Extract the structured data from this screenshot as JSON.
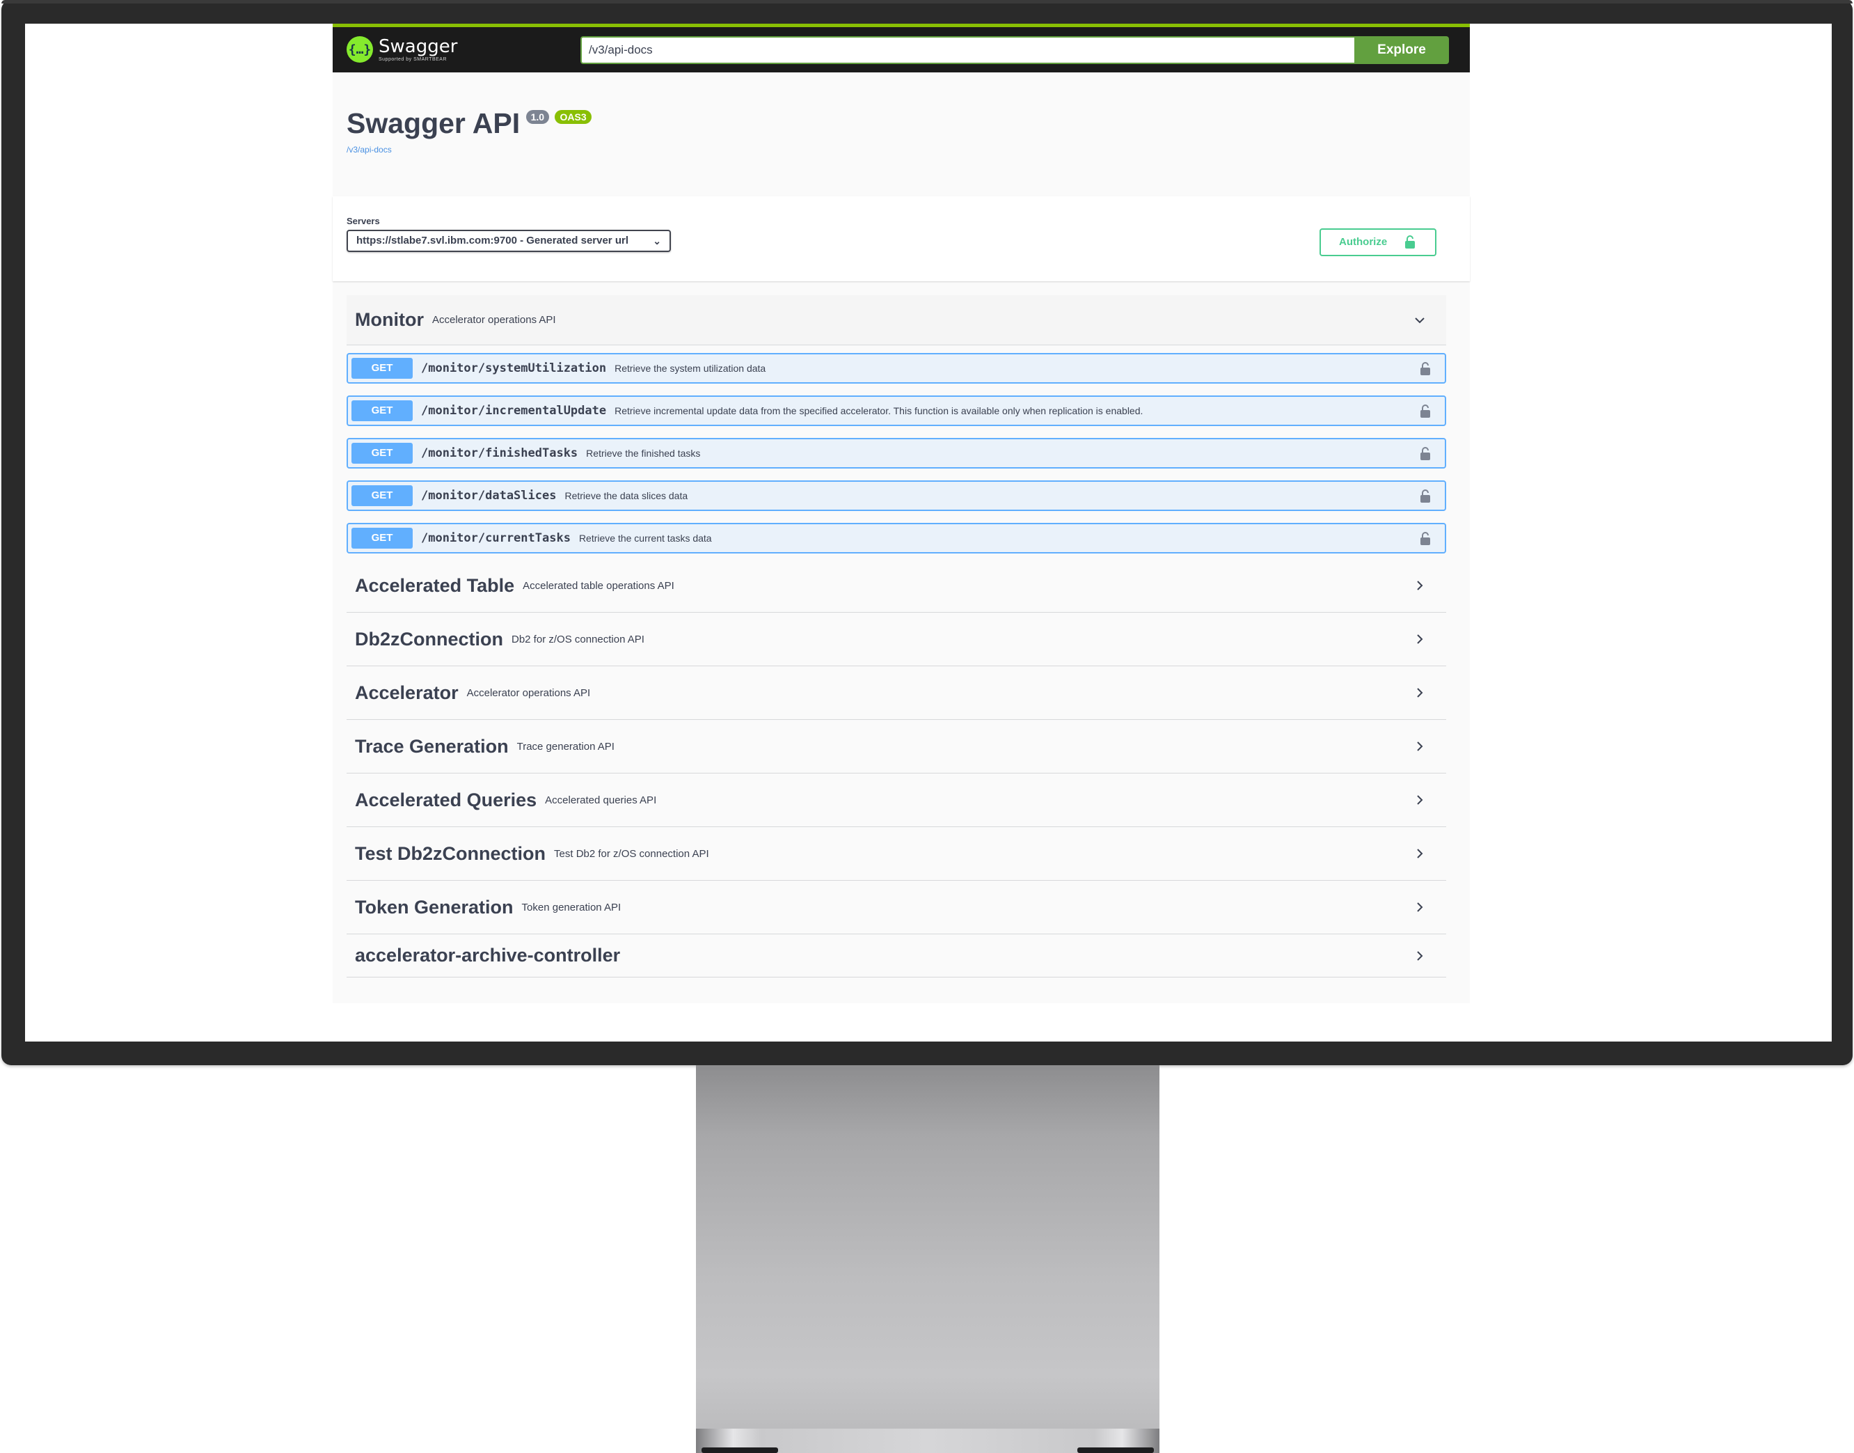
{
  "topbar": {
    "logo_title": "Swagger",
    "logo_subtitle": "Supported by SMARTBEAR",
    "url_value": "/v3/api-docs",
    "explore_label": "Explore"
  },
  "info": {
    "title": "Swagger API",
    "version": "1.0",
    "oas": "OAS3",
    "docs_link": "/v3/api-docs"
  },
  "servers": {
    "label": "Servers",
    "selected": "https://stlabe7.svl.ibm.com:9700 - Generated server url"
  },
  "authorize": {
    "label": "Authorize"
  },
  "monitor": {
    "name": "Monitor",
    "desc": "Accelerator operations API",
    "operations": [
      {
        "method": "GET",
        "path": "/monitor/systemUtilization",
        "summary": "Retrieve the system utilization data"
      },
      {
        "method": "GET",
        "path": "/monitor/incrementalUpdate",
        "summary": "Retrieve incremental update data from the specified accelerator. This function is available only when replication is enabled."
      },
      {
        "method": "GET",
        "path": "/monitor/finishedTasks",
        "summary": "Retrieve the finished tasks"
      },
      {
        "method": "GET",
        "path": "/monitor/dataSlices",
        "summary": "Retrieve the data slices data"
      },
      {
        "method": "GET",
        "path": "/monitor/currentTasks",
        "summary": "Retrieve the current tasks data"
      }
    ]
  },
  "tags": [
    {
      "name": "Accelerated Table",
      "desc": "Accelerated table operations API"
    },
    {
      "name": "Db2zConnection",
      "desc": "Db2 for z/OS connection API"
    },
    {
      "name": "Accelerator",
      "desc": "Accelerator operations API"
    },
    {
      "name": "Trace Generation",
      "desc": "Trace generation API"
    },
    {
      "name": "Accelerated Queries",
      "desc": "Accelerated queries API"
    },
    {
      "name": "Test Db2zConnection",
      "desc": "Test Db2 for z/OS connection API"
    },
    {
      "name": "Token Generation",
      "desc": "Token generation API"
    },
    {
      "name": "accelerator-archive-controller",
      "desc": ""
    }
  ],
  "colors": {
    "topbar_bg": "#1b1b1b",
    "explore_green": "#62a03f",
    "get_blue": "#61affe",
    "authorize_green": "#49cc90",
    "oas_badge": "#89bf04"
  }
}
